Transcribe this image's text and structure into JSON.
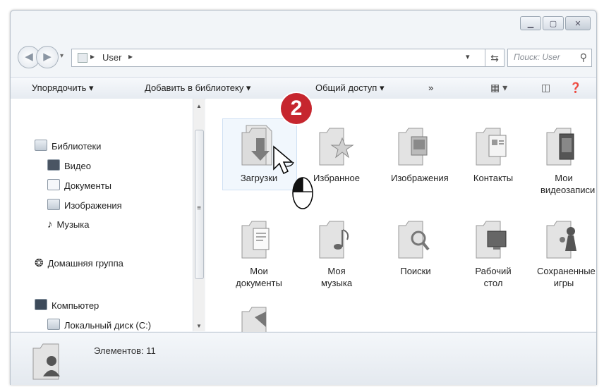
{
  "address": {
    "path": "User",
    "search_placeholder": "Поиск: User"
  },
  "toolbar": {
    "organize": "Упорядочить ▾",
    "add_to_library": "Добавить в библиотеку ▾",
    "share": "Общий доступ ▾",
    "more": "»"
  },
  "nav": {
    "libraries": "Библиотеки",
    "video": "Видео",
    "documents": "Документы",
    "pictures": "Изображения",
    "music": "Музыка",
    "homegroup": "Домашняя группа",
    "computer": "Компьютер",
    "local_disk": "Локальный диск (C:)"
  },
  "items": [
    {
      "label": "Загрузки"
    },
    {
      "label": "Избранное"
    },
    {
      "label": "Изображения"
    },
    {
      "label": "Контакты"
    },
    {
      "label": "Мои видеозаписи"
    },
    {
      "label": "Мои документы"
    },
    {
      "label": "Моя музыка"
    },
    {
      "label": "Поиски"
    },
    {
      "label": "Рабочий стол"
    },
    {
      "label": "Сохраненные игры"
    }
  ],
  "step_badge": "2",
  "details": {
    "count": "Элементов: 11"
  }
}
